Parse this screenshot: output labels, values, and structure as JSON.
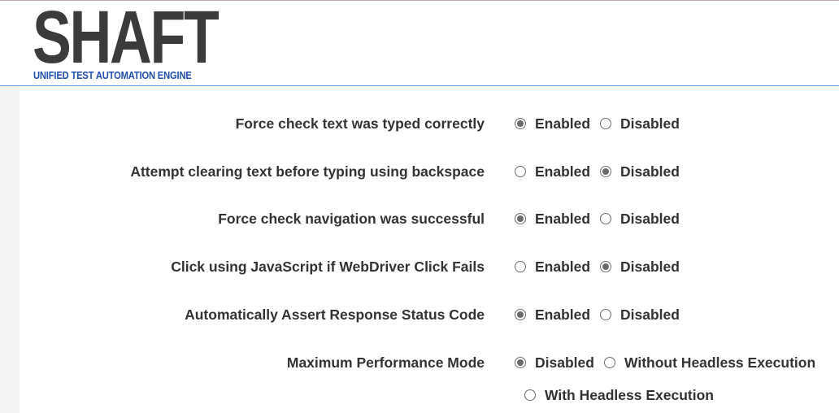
{
  "logo": {
    "title": "SHAFT",
    "subtitle": "UNIFIED TEST AUTOMATION ENGINE"
  },
  "settings": [
    {
      "label": "Force check text was typed correctly",
      "options": [
        {
          "label": "Enabled",
          "checked": true
        },
        {
          "label": "Disabled",
          "checked": false
        }
      ]
    },
    {
      "label": "Attempt clearing text before typing using backspace",
      "options": [
        {
          "label": "Enabled",
          "checked": false
        },
        {
          "label": "Disabled",
          "checked": true
        }
      ]
    },
    {
      "label": "Force check navigation was successful",
      "options": [
        {
          "label": "Enabled",
          "checked": true
        },
        {
          "label": "Disabled",
          "checked": false
        }
      ]
    },
    {
      "label": "Click using JavaScript if WebDriver Click Fails",
      "options": [
        {
          "label": "Enabled",
          "checked": false
        },
        {
          "label": "Disabled",
          "checked": true
        }
      ]
    },
    {
      "label": "Automatically Assert Response Status Code",
      "options": [
        {
          "label": "Enabled",
          "checked": true
        },
        {
          "label": "Disabled",
          "checked": false
        }
      ]
    },
    {
      "label": "Maximum Performance Mode",
      "options": [
        {
          "label": "Disabled",
          "checked": true
        },
        {
          "label": "Without Headless Execution",
          "checked": false
        },
        {
          "label": "With Headless Execution",
          "checked": false
        }
      ]
    }
  ]
}
